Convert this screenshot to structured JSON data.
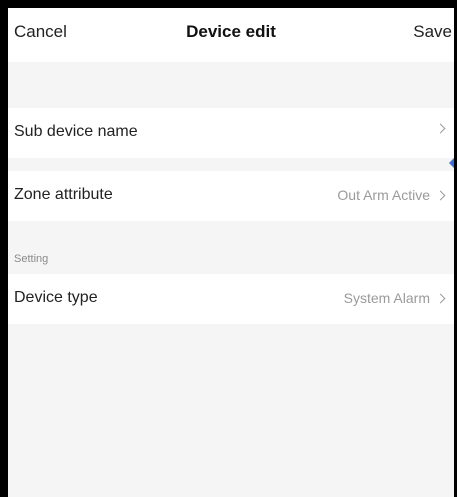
{
  "nav": {
    "cancel_label": "Cancel",
    "title": "Device edit",
    "save_label": "Save"
  },
  "rows": [
    {
      "label": "Sub device name",
      "value": ""
    },
    {
      "label": "Zone attribute",
      "value": "Out Arm Active"
    }
  ],
  "setting": {
    "header": "Setting",
    "rows": [
      {
        "label": "Device type",
        "value": "System Alarm"
      }
    ]
  },
  "colors": {
    "background": "#f5f5f5",
    "row_background": "#ffffff",
    "text": "#222222",
    "secondary_text": "#9a9a9a",
    "accent": "#3b6fd8"
  },
  "icons": {
    "chevron": "chevron-right-icon",
    "scroll_marker": "scroll-indicator-icon"
  }
}
